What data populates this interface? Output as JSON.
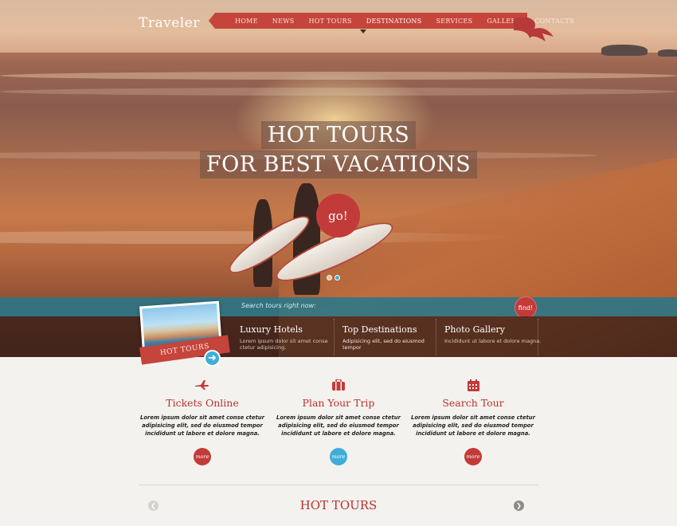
{
  "brand": {
    "logo": "Traveler"
  },
  "nav": {
    "items": [
      {
        "label": "HOME"
      },
      {
        "label": "NEWS"
      },
      {
        "label": "HOT TOURS"
      },
      {
        "label": "DESTINATIONS"
      },
      {
        "label": "SERVICES"
      },
      {
        "label": "GALLERY"
      },
      {
        "label": "CONTACTS"
      }
    ],
    "active": "DESTINATIONS",
    "color": "#c5443b"
  },
  "hero": {
    "line1": "HOT TOURS",
    "line2": "FOR BEST VACATIONS",
    "go_label": "go!",
    "slide_dots": 2,
    "active_dot": 2
  },
  "search": {
    "prompt": "Search tours right now:",
    "find_label": "find!"
  },
  "promo": {
    "ribbon_label": "HOT TOURS",
    "arrow_icon": "arrow-right-icon"
  },
  "features": [
    {
      "title": "Luxury Hotels",
      "text": "Lorem ipsum dolor sit amet conse ctetur adipisicing."
    },
    {
      "title": "Top Destinations",
      "text": "Adipisicing elit, sed do eiusmod tempor"
    },
    {
      "title": "Photo Gallery",
      "text": "Incididunt ut labore et dolore magna."
    }
  ],
  "services": [
    {
      "icon": "airplane-icon",
      "title": "Tickets Online",
      "text": "Lorem ipsum dolor sit amet conse ctetur adipisicing elit, sed do eiusmod tempor incididunt ut labore et dolore magna.",
      "more_label": "more",
      "more_color": "#c23b39"
    },
    {
      "icon": "suitcase-icon",
      "title": "Plan Your Trip",
      "text": "Lorem ipsum dolor sit amet conse ctetur adipisicing elit, sed do eiusmod tempor incididunt ut labore et dolore magna.",
      "more_label": "more",
      "more_color": "#3eaed8"
    },
    {
      "icon": "calendar-icon",
      "title": "Search Tour",
      "text": "Lorem ipsum dolor sit amet conse ctetur adipisicing elit, sed do eiusmod tempor incididunt ut labore et dolore magna.",
      "more_label": "more",
      "more_color": "#c23b39"
    }
  ],
  "hot_tours": {
    "title": "HOT TOURS",
    "prev_icon": "chevron-left-icon",
    "next_icon": "chevron-right-icon"
  },
  "colors": {
    "accent": "#c23b39",
    "secondary": "#3eaed8",
    "heading": "#b9322e"
  }
}
